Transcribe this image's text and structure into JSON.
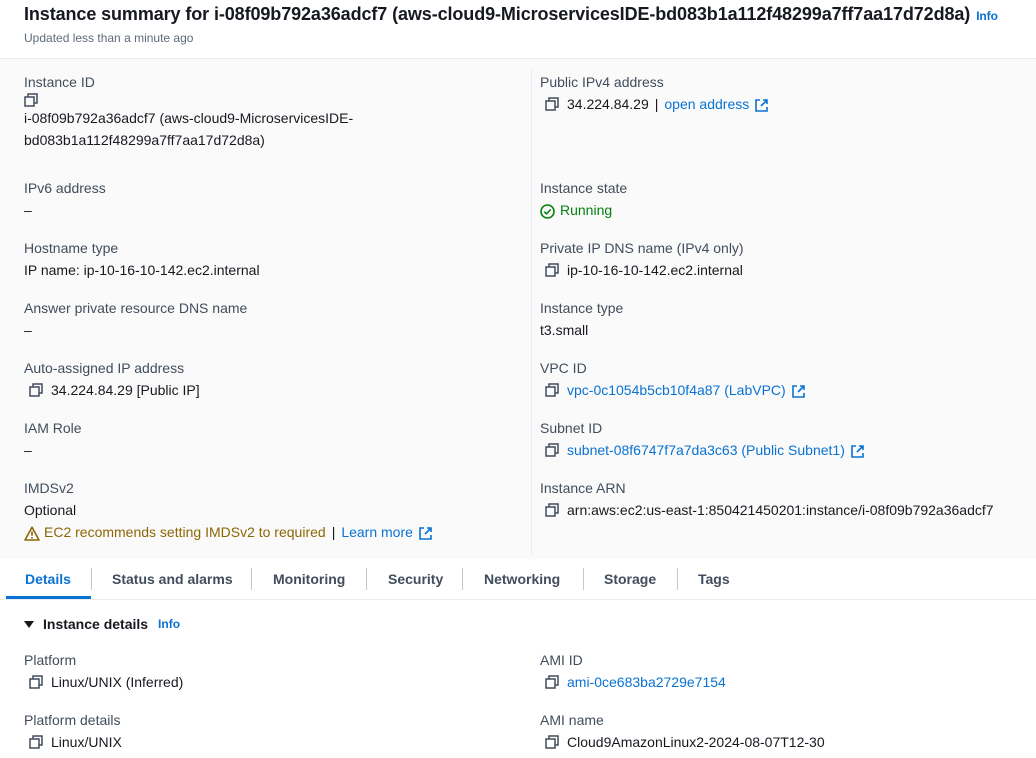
{
  "header": {
    "title": "Instance summary for i-08f09b792a36adcf7 (aws-cloud9-MicroservicesIDE-bd083b1a112f48299a7ff7aa17d72d8a)",
    "info": "Info",
    "updated": "Updated less than a minute ago"
  },
  "summary": {
    "instance_id": {
      "label": "Instance ID",
      "value_line1": "i-08f09b792a36adcf7 (aws-cloud9-MicroservicesIDE-",
      "value_line2": "bd083b1a112f48299a7ff7aa17d72d8a)"
    },
    "public_ipv4": {
      "label": "Public IPv4 address",
      "value": "34.224.84.29",
      "separator": "|",
      "link": "open address"
    },
    "ipv6": {
      "label": "IPv6 address",
      "value": "–"
    },
    "instance_state": {
      "label": "Instance state",
      "value": "Running"
    },
    "hostname_type": {
      "label": "Hostname type",
      "value": "IP name: ip-10-16-10-142.ec2.internal"
    },
    "private_dns": {
      "label": "Private IP DNS name (IPv4 only)",
      "value": "ip-10-16-10-142.ec2.internal"
    },
    "answer_dns": {
      "label": "Answer private resource DNS name",
      "value": "–"
    },
    "instance_type": {
      "label": "Instance type",
      "value": "t3.small"
    },
    "auto_ip": {
      "label": "Auto-assigned IP address",
      "value": "34.224.84.29 [Public IP]"
    },
    "vpc_id": {
      "label": "VPC ID",
      "value": "vpc-0c1054b5cb10f4a87 (LabVPC)"
    },
    "iam_role": {
      "label": "IAM Role",
      "value": "–"
    },
    "subnet_id": {
      "label": "Subnet ID",
      "value": "subnet-08f6747f7a7da3c63 (Public Subnet1)"
    },
    "imdsv2": {
      "label": "IMDSv2",
      "value": "Optional",
      "warning": "EC2 recommends setting IMDSv2 to required",
      "separator": "|",
      "learn_more": "Learn more"
    },
    "instance_arn": {
      "label": "Instance ARN",
      "value": "arn:aws:ec2:us-east-1:850421450201:instance/i-08f09b792a36adcf7"
    }
  },
  "tabs": [
    "Details",
    "Status and alarms",
    "Monitoring",
    "Security",
    "Networking",
    "Storage",
    "Tags"
  ],
  "details": {
    "title": "Instance details",
    "info": "Info",
    "platform": {
      "label": "Platform",
      "value": "Linux/UNIX (Inferred)"
    },
    "ami_id": {
      "label": "AMI ID",
      "value": "ami-0ce683ba2729e7154"
    },
    "platform_details": {
      "label": "Platform details",
      "value": "Linux/UNIX"
    },
    "ami_name": {
      "label": "AMI name",
      "value": "Cloud9AmazonLinux2-2024-08-07T12-30"
    }
  },
  "colors": {
    "link": "#0972d3",
    "running": "#037f0c",
    "warning": "#8d6605",
    "text": "#16191f",
    "label": "#414d5c"
  }
}
